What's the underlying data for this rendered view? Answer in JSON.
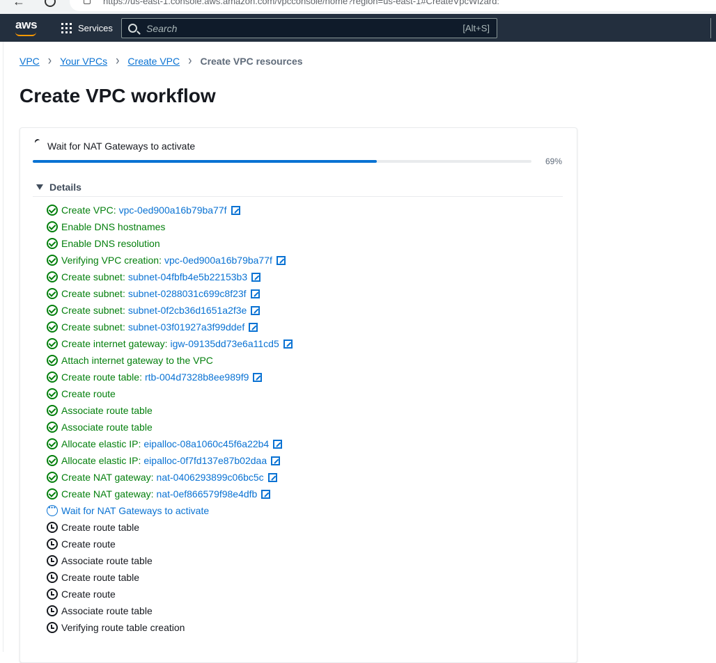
{
  "browser": {
    "url": "https://us-east-1.console.aws.amazon.com/vpcconsole/home?region=us-east-1#CreateVpcWizard:"
  },
  "topnav": {
    "logo": "aws",
    "services_label": "Services",
    "search_placeholder": "Search",
    "search_shortcut": "[Alt+S]"
  },
  "breadcrumb": {
    "items": [
      "VPC",
      "Your VPCs",
      "Create VPC"
    ],
    "current": "Create VPC resources"
  },
  "page_title": "Create VPC workflow",
  "progress": {
    "label": "Wait for NAT Gateways to activate",
    "percent_text": "69%",
    "percent": 69
  },
  "details": {
    "label": "Details"
  },
  "colors": {
    "success": "#037f0c",
    "link": "#0972d3",
    "nav_bg": "#232f3e"
  },
  "steps": [
    {
      "status": "success",
      "label": "Create VPC:",
      "link": "vpc-0ed900a16b79ba77f"
    },
    {
      "status": "success",
      "label": "Enable DNS hostnames",
      "link": ""
    },
    {
      "status": "success",
      "label": "Enable DNS resolution",
      "link": ""
    },
    {
      "status": "success",
      "label": "Verifying VPC creation:",
      "link": "vpc-0ed900a16b79ba77f"
    },
    {
      "status": "success",
      "label": "Create subnet:",
      "link": "subnet-04fbfb4e5b22153b3"
    },
    {
      "status": "success",
      "label": "Create subnet:",
      "link": "subnet-0288031c699c8f23f"
    },
    {
      "status": "success",
      "label": "Create subnet:",
      "link": "subnet-0f2cb36d1651a2f3e"
    },
    {
      "status": "success",
      "label": "Create subnet:",
      "link": "subnet-03f01927a3f99ddef"
    },
    {
      "status": "success",
      "label": "Create internet gateway:",
      "link": "igw-09135dd73e6a11cd5"
    },
    {
      "status": "success",
      "label": "Attach internet gateway to the VPC",
      "link": ""
    },
    {
      "status": "success",
      "label": "Create route table:",
      "link": "rtb-004d7328b8ee989f9"
    },
    {
      "status": "success",
      "label": "Create route",
      "link": ""
    },
    {
      "status": "success",
      "label": "Associate route table",
      "link": ""
    },
    {
      "status": "success",
      "label": "Associate route table",
      "link": ""
    },
    {
      "status": "success",
      "label": "Allocate elastic IP:",
      "link": "eipalloc-08a1060c45f6a22b4"
    },
    {
      "status": "success",
      "label": "Allocate elastic IP:",
      "link": "eipalloc-0f7fd137e87b02daa"
    },
    {
      "status": "success",
      "label": "Create NAT gateway:",
      "link": "nat-0406293899c06bc5c"
    },
    {
      "status": "success",
      "label": "Create NAT gateway:",
      "link": "nat-0ef866579f98e4dfb"
    },
    {
      "status": "in-progress",
      "label": "Wait for NAT Gateways to activate",
      "link": ""
    },
    {
      "status": "pending",
      "label": "Create route table",
      "link": ""
    },
    {
      "status": "pending",
      "label": "Create route",
      "link": ""
    },
    {
      "status": "pending",
      "label": "Associate route table",
      "link": ""
    },
    {
      "status": "pending",
      "label": "Create route table",
      "link": ""
    },
    {
      "status": "pending",
      "label": "Create route",
      "link": ""
    },
    {
      "status": "pending",
      "label": "Associate route table",
      "link": ""
    },
    {
      "status": "pending",
      "label": "Verifying route table creation",
      "link": ""
    }
  ]
}
